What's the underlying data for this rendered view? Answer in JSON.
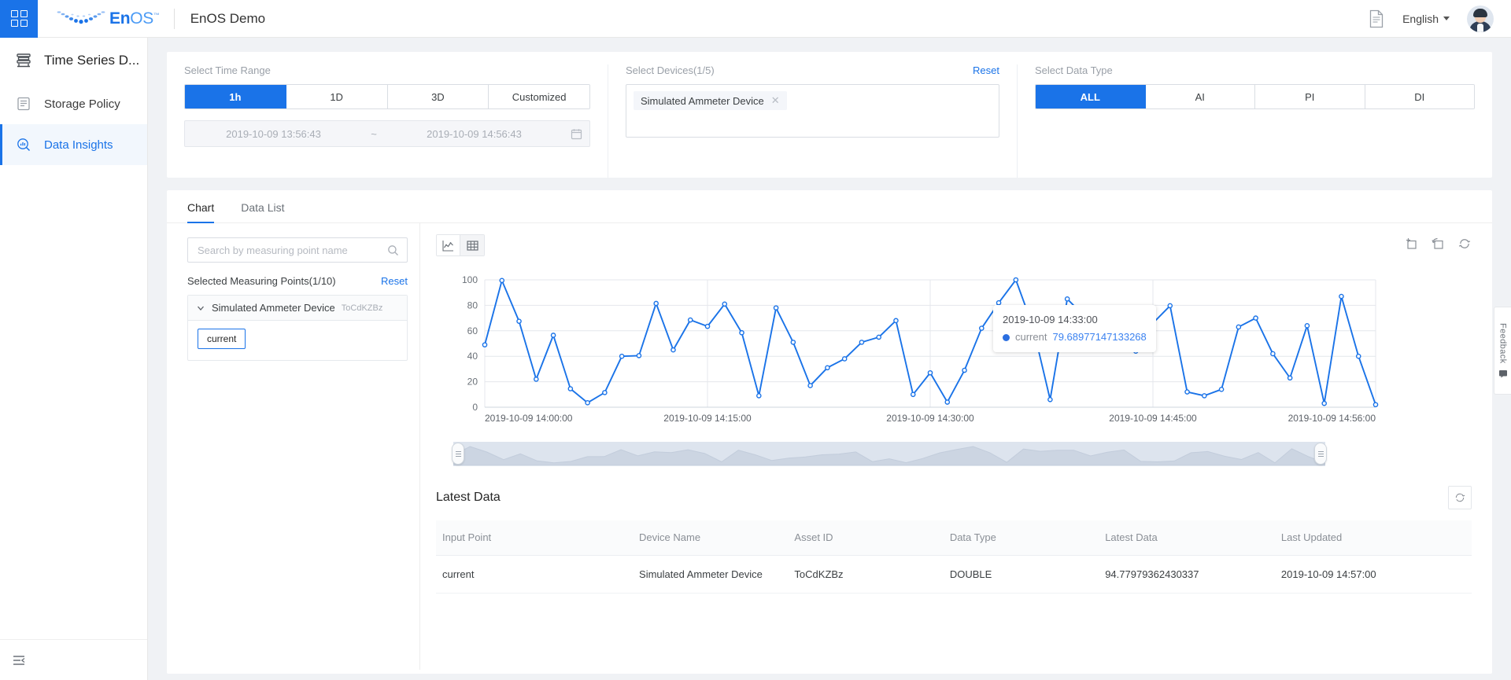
{
  "header": {
    "apps_icon": "grid-icon",
    "logo_en": "En",
    "logo_os": "OS",
    "logo_tm": "™",
    "title": "EnOS Demo",
    "doc_icon": "document-icon",
    "language": "English",
    "avatar": "user-avatar"
  },
  "sidebar": {
    "title": "Time Series D...",
    "items": [
      {
        "label": "Storage Policy",
        "icon": "storage-icon",
        "active": false
      },
      {
        "label": "Data Insights",
        "icon": "insights-icon",
        "active": true
      }
    ],
    "collapse_icon": "collapse-sidebar-icon"
  },
  "filters": {
    "time_range_label": "Select Time Range",
    "time_range_options": [
      "1h",
      "1D",
      "3D",
      "Customized"
    ],
    "time_range_selected": "1h",
    "date_start": "2019-10-09 13:56:43",
    "date_separator": "~",
    "date_end": "2019-10-09 14:56:43",
    "calendar_icon": "calendar-icon",
    "devices_label": "Select Devices(1/5)",
    "devices_reset": "Reset",
    "device_tags": [
      "Simulated Ammeter Device"
    ],
    "data_type_label": "Select Data Type",
    "data_type_options": [
      "ALL",
      "AI",
      "PI",
      "DI"
    ],
    "data_type_selected": "ALL"
  },
  "content": {
    "tabs": [
      {
        "label": "Chart",
        "active": true
      },
      {
        "label": "Data List",
        "active": false
      }
    ],
    "search_placeholder": "Search by measuring point name",
    "search_value": "",
    "search_icon": "search-icon",
    "selected_points_label": "Selected Measuring Points(1/10)",
    "points_reset": "Reset",
    "tree": {
      "device_name": "Simulated Ammeter Device",
      "device_id": "ToCdKZBz",
      "chips": [
        "current"
      ]
    },
    "view_toggle": [
      "line-chart-icon",
      "table-icon"
    ],
    "chart_tools": [
      "zoom-select-icon",
      "restore-icon",
      "refresh-icon"
    ]
  },
  "chart_data": {
    "type": "line",
    "title": "",
    "xlabel": "",
    "ylabel": "",
    "ylim": [
      0,
      100
    ],
    "yticks": [
      0,
      20,
      40,
      60,
      80,
      100
    ],
    "grid": true,
    "legend": [
      "current"
    ],
    "xticks": [
      "2019-10-09 14:00:00",
      "2019-10-09 14:15:00",
      "2019-10-09 14:30:00",
      "2019-10-09 14:45:00",
      "2019-10-09 14:56:00"
    ],
    "series": [
      {
        "name": "current",
        "color": "#1a73e8",
        "values": [
          49,
          99.5,
          67.5,
          22,
          56.5,
          14.5,
          3.5,
          11.5,
          40,
          40.5,
          81.5,
          45,
          68.5,
          63.5,
          81,
          58.5,
          9,
          78,
          51,
          17,
          31,
          38,
          51,
          55,
          68,
          10,
          27,
          4,
          29,
          62,
          82,
          100,
          63,
          6,
          85,
          71.5,
          78,
          78,
          44,
          66,
          79.69,
          12,
          9,
          14,
          63,
          70,
          42,
          23,
          64,
          3,
          87,
          40,
          2
        ]
      }
    ],
    "tooltip": {
      "date": "2019-10-09 14:33:00",
      "series_name": "current",
      "value": "79.68977147133268"
    },
    "datazoom": {
      "start": 0,
      "end": 100
    }
  },
  "latest": {
    "title": "Latest Data",
    "refresh_icon": "refresh-icon",
    "columns": [
      "Input Point",
      "Device Name",
      "Asset ID",
      "Data Type",
      "Latest Data",
      "Last Updated"
    ],
    "rows": [
      {
        "input_point": "current",
        "device_name": "Simulated Ammeter Device",
        "asset_id": "ToCdKZBz",
        "data_type": "DOUBLE",
        "latest_data": "94.77979362430337",
        "last_updated": "2019-10-09 14:57:00"
      }
    ]
  },
  "feedback": {
    "label": "Feedback",
    "icon": "feedback-icon"
  }
}
